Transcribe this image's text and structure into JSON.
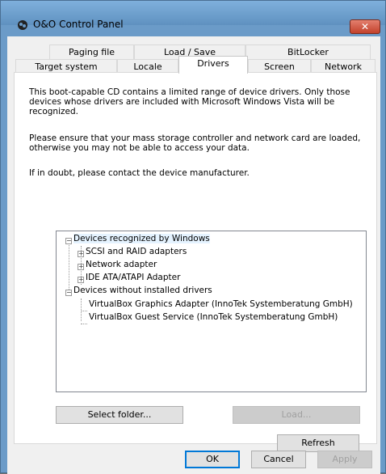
{
  "window": {
    "title": "O&O Control Panel",
    "close_glyph": "✕"
  },
  "tabs_row1": [
    "Paging file",
    "Load / Save",
    "BitLocker"
  ],
  "tabs_row2": [
    "Target system",
    "Locale",
    "Drivers",
    "Screen",
    "Network"
  ],
  "active_tab": "Drivers",
  "content": {
    "para1": "This boot-capable CD contains a limited range of device drivers. Only those devices whose drivers are included with Microsoft Windows Vista will be recognized.",
    "para2": "Please ensure that your mass storage controller and network card are loaded, otherwise you may not be able to access your data.",
    "para3": "If in doubt, please contact the device manufacturer."
  },
  "tree": {
    "root1": "Devices recognized by Windows",
    "root1_children": [
      "SCSI and RAID adapters",
      "Network adapter",
      "IDE ATA/ATAPI Adapter"
    ],
    "root2": "Devices without installed drivers",
    "root2_children": [
      "VirtualBox Graphics Adapter (InnoTek Systemberatung GmbH)",
      "VirtualBox Guest Service (InnoTek Systemberatung GmbH)"
    ]
  },
  "buttons": {
    "select_folder": "Select folder...",
    "load": "Load...",
    "refresh": "Refresh",
    "ok": "OK",
    "cancel": "Cancel",
    "apply": "Apply"
  },
  "colors": {
    "titlebar": "#6b9bc8",
    "close": "#c2412b",
    "selection": "#e5f3ff",
    "focus": "#0078d7"
  }
}
